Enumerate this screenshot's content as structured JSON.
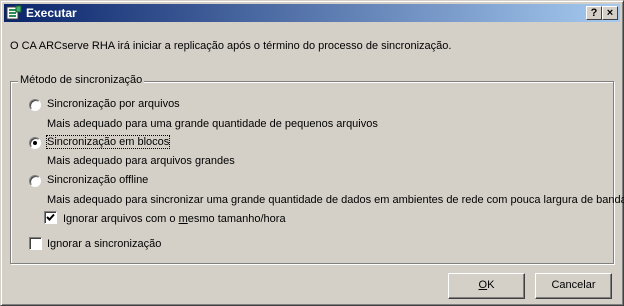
{
  "window": {
    "title": "Executar",
    "help_label": "?",
    "close_label": "×"
  },
  "intro_text": "O CA ARCserve RHA irá iniciar a replicação após o término do processo de sincronização.",
  "sync_group": {
    "legend": "Método de sincronização",
    "options": [
      {
        "label": "Sincronização por arquivos",
        "description": "Mais adequado para uma grande quantidade de pequenos arquivos",
        "selected": false
      },
      {
        "label": "Sincronização em blocos",
        "description": "Mais adequado para arquivos grandes",
        "selected": true
      },
      {
        "label": "Sincronização offline",
        "description": "Mais adequado para sincronizar uma grande quantidade de dados em ambientes de rede com pouca largura de banda.",
        "selected": false
      }
    ],
    "ignore_same_size_pre": "Ignorar arquivos com o ",
    "ignore_same_size_key": "m",
    "ignore_same_size_post": "esmo tamanho/hora",
    "ignore_same_size_checked": true,
    "ignore_sync_label": "Ignorar a sincronização",
    "ignore_sync_checked": false
  },
  "buttons": {
    "ok_key": "O",
    "ok_rest": "K",
    "cancel_label": "Cancelar"
  }
}
